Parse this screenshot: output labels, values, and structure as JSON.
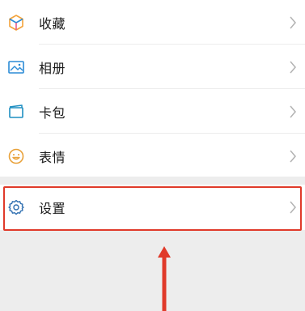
{
  "menu": {
    "items": [
      {
        "label": "收藏",
        "icon": "favorites-cube-icon"
      },
      {
        "label": "相册",
        "icon": "album-photo-icon"
      },
      {
        "label": "卡包",
        "icon": "card-wallet-icon"
      },
      {
        "label": "表情",
        "icon": "emoji-smile-icon"
      }
    ],
    "settings": {
      "label": "设置",
      "icon": "settings-gear-icon"
    }
  },
  "colors": {
    "accent_red": "#e03a2a",
    "favorites_orange": "#f3a33b",
    "album_blue": "#2b8bd6",
    "card_teal": "#1f8fc2",
    "emoji_yellow": "#e9a23b",
    "settings_blue": "#2f6fb0"
  }
}
